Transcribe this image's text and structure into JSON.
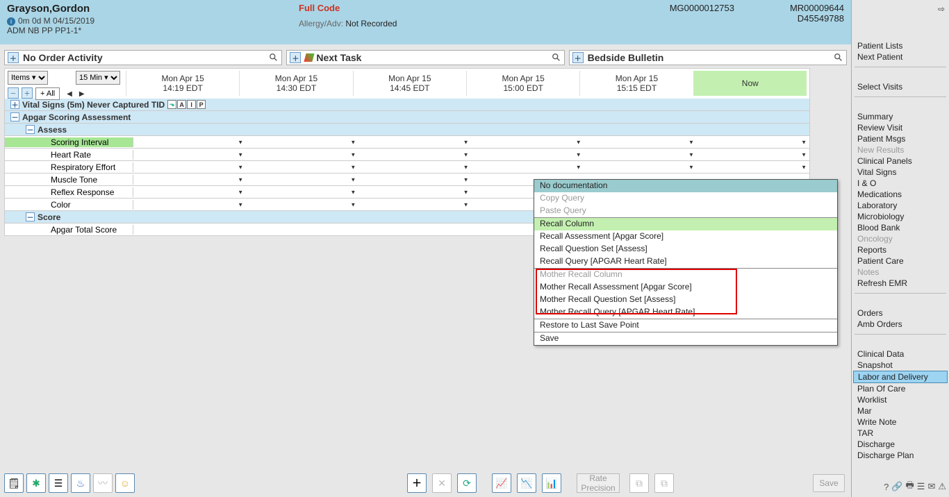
{
  "patient": {
    "name": "Grayson,Gordon",
    "age_sex_dob": "0m 0d  M  04/15/2019",
    "location": "ADM NB  PP  PP1-1*",
    "code_status": "Full Code",
    "allergy_label": "Allergy/Adv:",
    "allergy_val": "Not Recorded",
    "mrn1": "MG0000012753",
    "mrn2": "MR00009644",
    "encounter": "D45549788"
  },
  "sections": {
    "order_activity": "No Order Activity",
    "next_task": "Next Task",
    "bedside": "Bedside Bulletin"
  },
  "toolbar": {
    "items_label": "Items ▾",
    "interval_label": "15 Min ▾",
    "plus_all": "+ All",
    "now_label": "Now"
  },
  "time_cols": [
    {
      "d": "Mon Apr 15",
      "t": "14:19 EDT"
    },
    {
      "d": "Mon Apr 15",
      "t": "14:30 EDT"
    },
    {
      "d": "Mon Apr 15",
      "t": "14:45 EDT"
    },
    {
      "d": "Mon Apr 15",
      "t": "15:00 EDT"
    },
    {
      "d": "Mon Apr 15",
      "t": "15:15 EDT"
    }
  ],
  "grid": {
    "vital_signs": "Vital Signs (5m) Never Captured  TID",
    "apgar": "Apgar Scoring Assessment",
    "assess": "Assess",
    "scoring_interval": "Scoring Interval",
    "heart_rate": "Heart Rate",
    "resp_effort": "Respiratory Effort",
    "muscle_tone": "Muscle Tone",
    "reflex": "Reflex Response",
    "color": "Color",
    "score_group": "Score",
    "total": "Apgar Total Score"
  },
  "context_menu": {
    "no_doc": "No documentation",
    "copy_q": "Copy Query",
    "paste_q": "Paste Query",
    "recall_col": "Recall Column",
    "recall_assess": "Recall Assessment [Apgar Score]",
    "recall_qs": "Recall Question Set [Assess]",
    "recall_query": "Recall Query [APGAR Heart Rate]",
    "mother_col": "Mother Recall Column",
    "mother_assess": "Mother Recall Assessment [Apgar Score]",
    "mother_qs": "Mother Recall Question Set [Assess]",
    "mother_query": "Mother Recall Query [APGAR Heart Rate]",
    "restore": "Restore to Last Save Point",
    "save": "Save"
  },
  "right_nav": {
    "g1": [
      "Patient Lists",
      "Next Patient"
    ],
    "g2": [
      "Select Visits"
    ],
    "g3": [
      {
        "l": "Summary"
      },
      {
        "l": "Review Visit"
      },
      {
        "l": "Patient Msgs"
      },
      {
        "l": "New Results",
        "d": true
      },
      {
        "l": "Clinical Panels"
      },
      {
        "l": "Vital Signs"
      },
      {
        "l": "I & O"
      },
      {
        "l": "Medications"
      },
      {
        "l": "Laboratory"
      },
      {
        "l": "Microbiology"
      },
      {
        "l": "Blood Bank"
      },
      {
        "l": "Oncology",
        "d": true
      },
      {
        "l": "Reports"
      },
      {
        "l": "Patient Care"
      },
      {
        "l": "Notes",
        "d": true
      },
      {
        "l": "Refresh EMR"
      }
    ],
    "g4": [
      "Orders",
      "Amb Orders"
    ],
    "g5": [
      {
        "l": "Clinical Data"
      },
      {
        "l": "Snapshot"
      },
      {
        "l": "Labor and Delivery",
        "c": true
      },
      {
        "l": "Plan Of Care"
      },
      {
        "l": "Worklist"
      },
      {
        "l": "Mar"
      },
      {
        "l": "Write Note"
      },
      {
        "l": "TAR"
      },
      {
        "l": "Discharge"
      },
      {
        "l": "Discharge Plan"
      }
    ]
  },
  "bottom": {
    "rate_precision_1": "Rate",
    "rate_precision_2": "Precision",
    "save": "Save"
  }
}
